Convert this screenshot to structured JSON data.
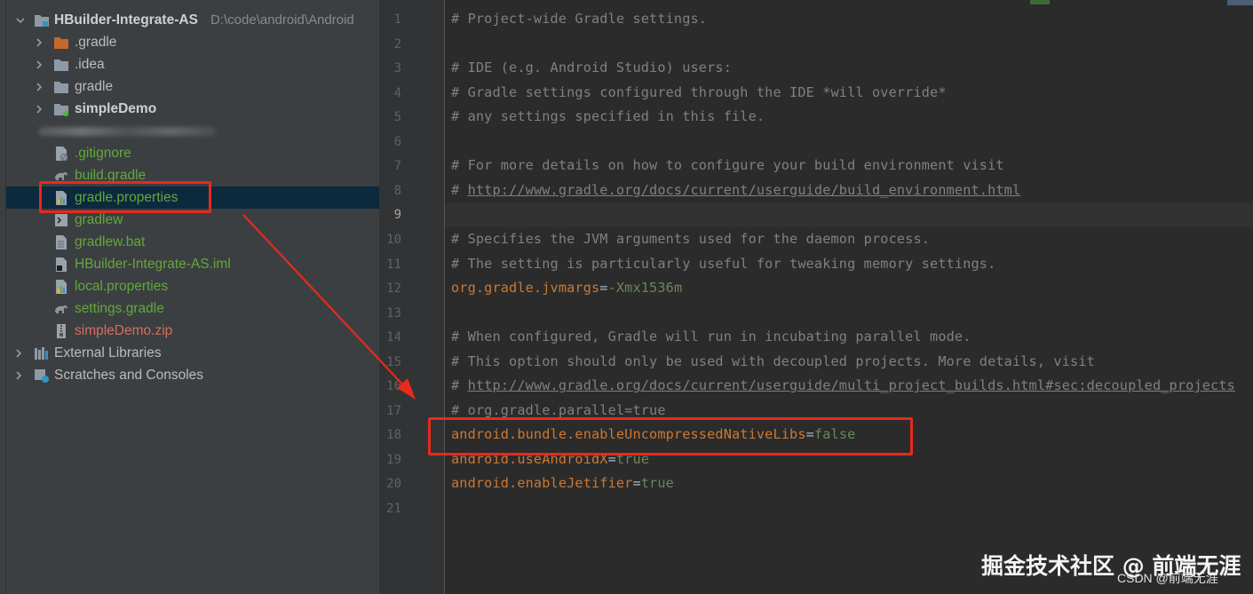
{
  "project_tree": {
    "root": {
      "name": "HBuilder-Integrate-AS",
      "path": "D:\\code\\android\\Android"
    },
    "items": [
      {
        "label": ".gradle",
        "kind": "folder-orange",
        "expandable": true,
        "style": "normal"
      },
      {
        "label": ".idea",
        "kind": "folder",
        "expandable": true,
        "style": "normal"
      },
      {
        "label": "gradle",
        "kind": "folder",
        "expandable": true,
        "style": "normal"
      },
      {
        "label": "simpleDemo",
        "kind": "module-folder",
        "expandable": true,
        "style": "bold"
      },
      {
        "label": "",
        "kind": "blurred",
        "expandable": false,
        "style": "normal"
      },
      {
        "label": ".gitignore",
        "kind": "file-ignore",
        "expandable": false,
        "style": "green"
      },
      {
        "label": "build.gradle",
        "kind": "file-gradle",
        "expandable": false,
        "style": "green"
      },
      {
        "label": "gradle.properties",
        "kind": "file-properties",
        "expandable": false,
        "style": "green",
        "selected": true
      },
      {
        "label": "gradlew",
        "kind": "file-script",
        "expandable": false,
        "style": "green"
      },
      {
        "label": "gradlew.bat",
        "kind": "file-text",
        "expandable": false,
        "style": "green"
      },
      {
        "label": "HBuilder-Integrate-AS.iml",
        "kind": "file-iml",
        "expandable": false,
        "style": "green"
      },
      {
        "label": "local.properties",
        "kind": "file-properties",
        "expandable": false,
        "style": "green"
      },
      {
        "label": "settings.gradle",
        "kind": "file-gradle",
        "expandable": false,
        "style": "green"
      },
      {
        "label": "simpleDemo.zip",
        "kind": "file-zip",
        "expandable": false,
        "style": "red"
      }
    ],
    "bottom_items": [
      {
        "label": "External Libraries",
        "kind": "libraries"
      },
      {
        "label": "Scratches and Consoles",
        "kind": "scratches"
      }
    ]
  },
  "editor": {
    "active_line": 9,
    "lines": [
      {
        "n": "1",
        "parts": [
          {
            "t": "# Project-wide Gradle settings.",
            "c": "cmt"
          }
        ]
      },
      {
        "n": "2",
        "parts": []
      },
      {
        "n": "3",
        "parts": [
          {
            "t": "# IDE (e.g. Android Studio) users:",
            "c": "cmt"
          }
        ]
      },
      {
        "n": "4",
        "parts": [
          {
            "t": "# Gradle settings configured through the IDE *will override*",
            "c": "cmt"
          }
        ]
      },
      {
        "n": "5",
        "parts": [
          {
            "t": "# any settings specified in this file.",
            "c": "cmt"
          }
        ]
      },
      {
        "n": "6",
        "parts": []
      },
      {
        "n": "7",
        "parts": [
          {
            "t": "# For more details on how to configure your build environment visit",
            "c": "cmt"
          }
        ]
      },
      {
        "n": "8",
        "parts": [
          {
            "t": "# ",
            "c": "cmt"
          },
          {
            "t": "http://www.gradle.org/docs/current/userguide/build_environment.html",
            "c": "cmt url"
          }
        ]
      },
      {
        "n": "9",
        "parts": []
      },
      {
        "n": "10",
        "parts": [
          {
            "t": "# Specifies the JVM arguments used for the daemon process.",
            "c": "cmt"
          }
        ]
      },
      {
        "n": "11",
        "parts": [
          {
            "t": "# The setting is particularly useful for tweaking memory settings.",
            "c": "cmt"
          }
        ]
      },
      {
        "n": "12",
        "parts": [
          {
            "t": "org.gradle.jvmargs",
            "c": "key"
          },
          {
            "t": "=",
            "c": "eq"
          },
          {
            "t": "-Xmx1536m",
            "c": "val"
          }
        ]
      },
      {
        "n": "13",
        "parts": []
      },
      {
        "n": "14",
        "parts": [
          {
            "t": "# When configured, Gradle will run in incubating parallel mode.",
            "c": "cmt"
          }
        ]
      },
      {
        "n": "15",
        "parts": [
          {
            "t": "# This option should only be used with decoupled projects. More details, visit",
            "c": "cmt"
          }
        ]
      },
      {
        "n": "16",
        "parts": [
          {
            "t": "# ",
            "c": "cmt"
          },
          {
            "t": "http://www.gradle.org/docs/current/userguide/multi_project_builds.html#sec:decoupled_projects",
            "c": "cmt url"
          }
        ]
      },
      {
        "n": "17",
        "parts": [
          {
            "t": "# org.gradle.parallel=true",
            "c": "cmt"
          }
        ]
      },
      {
        "n": "18",
        "parts": [
          {
            "t": "android.bundle.enableUncompressedNativeLibs",
            "c": "key"
          },
          {
            "t": "=",
            "c": "eq"
          },
          {
            "t": "false",
            "c": "val"
          }
        ]
      },
      {
        "n": "19",
        "parts": [
          {
            "t": "android.useAndroidX",
            "c": "key"
          },
          {
            "t": "=",
            "c": "eq"
          },
          {
            "t": "true",
            "c": "val"
          }
        ]
      },
      {
        "n": "20",
        "parts": [
          {
            "t": "android.enableJetifier",
            "c": "key"
          },
          {
            "t": "=",
            "c": "eq"
          },
          {
            "t": "true",
            "c": "val"
          }
        ]
      },
      {
        "n": "21",
        "parts": []
      }
    ]
  },
  "watermark": {
    "main": "掘金技术社区 @ 前端无涯",
    "sub": "CSDN @前端无涯"
  },
  "colors": {
    "annotation_red": "#e8291c",
    "keyword_orange": "#cc7832",
    "value_green": "#6a8759",
    "vcs_green": "#62a83c"
  }
}
